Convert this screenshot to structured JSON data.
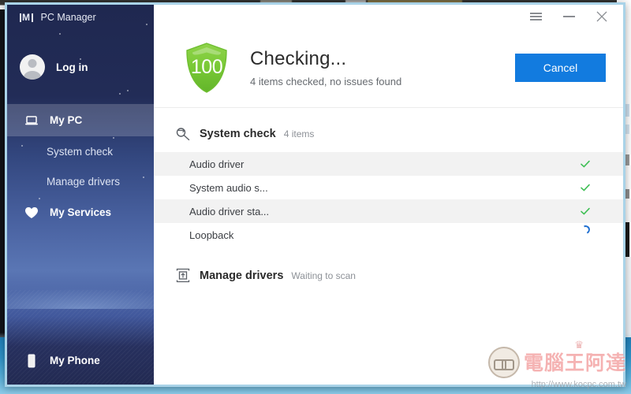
{
  "window": {
    "title": "PC Manager",
    "controls": {
      "menu": "menu",
      "minimize": "minimize",
      "close": "close"
    }
  },
  "sidebar": {
    "brand": "PC Manager",
    "account": {
      "label": "Log in"
    },
    "items": [
      {
        "label": "My PC",
        "icon": "laptop-icon",
        "active": true,
        "level": "primary"
      },
      {
        "label": "System check",
        "icon": "",
        "active": false,
        "level": "sub"
      },
      {
        "label": "Manage drivers",
        "icon": "",
        "active": false,
        "level": "sub"
      },
      {
        "label": "My Services",
        "icon": "heart-icon",
        "active": false,
        "level": "primary"
      }
    ],
    "bottom_item": {
      "label": "My Phone",
      "icon": "phone-icon"
    }
  },
  "header": {
    "score": "100",
    "title": "Checking...",
    "subtitle": "4 items checked, no issues found",
    "cancel_label": "Cancel"
  },
  "content": {
    "system_check": {
      "title": "System check",
      "meta": "4 items",
      "icon": "scan-icon",
      "rows": [
        {
          "label": "Audio driver",
          "status": "done"
        },
        {
          "label": "System audio s...",
          "status": "done"
        },
        {
          "label": "Audio driver sta...",
          "status": "done"
        },
        {
          "label": "Loopback",
          "status": "scanning"
        }
      ]
    },
    "manage_drivers": {
      "title": "Manage drivers",
      "meta": "Waiting to scan",
      "icon": "driver-icon"
    }
  },
  "watermark": {
    "text": "電腦王阿達",
    "url": "http://www.kocpc.com.tw"
  },
  "colors": {
    "accent": "#127bdf",
    "success": "#3fbf55",
    "shield": "#7ac943",
    "sidebar_top": "#1f2850"
  }
}
